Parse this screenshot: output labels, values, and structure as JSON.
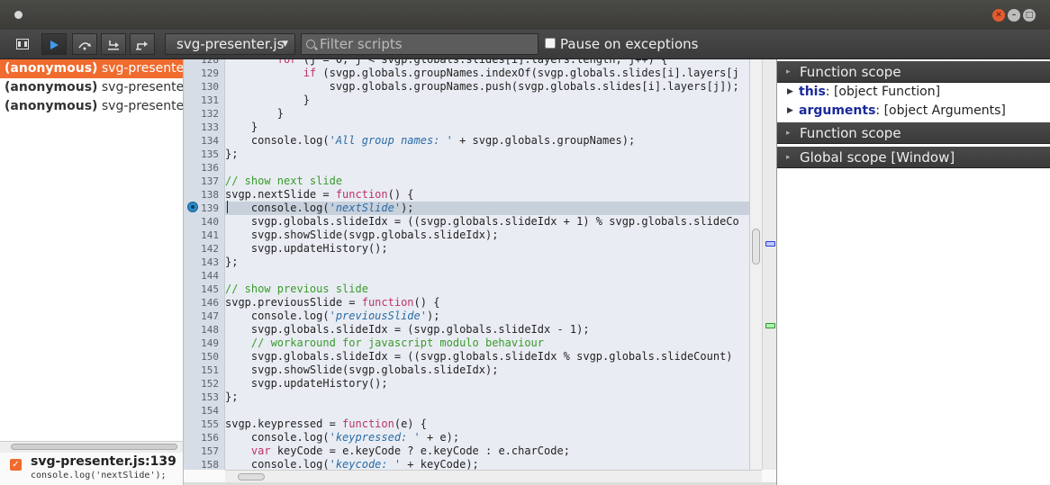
{
  "window": {
    "close": "✕",
    "minimize": "–",
    "maximize": "□"
  },
  "toolbar": {
    "script_name": "svg-presenter.js",
    "filter_placeholder": "Filter scripts",
    "pause_label": "Pause on exceptions"
  },
  "callstack": [
    {
      "fn": "(anonymous)",
      "file": "svg-presenter.js",
      "selected": true
    },
    {
      "fn": "(anonymous)",
      "file": "svg-presenter.js",
      "selected": false
    },
    {
      "fn": "(anonymous)",
      "file": "svg-presenter.js",
      "selected": false
    }
  ],
  "breakpoint": {
    "location": "svg-presenter.js:139",
    "source": "console.log('nextSlide');"
  },
  "editor": {
    "current_line": 139,
    "lines": [
      {
        "n": "128",
        "code": "        for (j = 0; j < svgp.globals.slides[i].layers.length; j++) {"
      },
      {
        "n": "129",
        "code": "            if (svgp.globals.groupNames.indexOf(svgp.globals.slides[i].layers[j"
      },
      {
        "n": "130",
        "code": "                svgp.globals.groupNames.push(svgp.globals.slides[i].layers[j]);"
      },
      {
        "n": "131",
        "code": "            }"
      },
      {
        "n": "132",
        "code": "        }"
      },
      {
        "n": "133",
        "code": "    }"
      },
      {
        "n": "134",
        "code": "    console.log('All group names: ' + svgp.globals.groupNames);"
      },
      {
        "n": "135",
        "code": "};"
      },
      {
        "n": "136",
        "code": ""
      },
      {
        "n": "137",
        "code": "// show next slide"
      },
      {
        "n": "138",
        "code": "svgp.nextSlide = function() {"
      },
      {
        "n": "139",
        "code": "    console.log('nextSlide');"
      },
      {
        "n": "140",
        "code": "    svgp.globals.slideIdx = ((svgp.globals.slideIdx + 1) % svgp.globals.slideCo"
      },
      {
        "n": "141",
        "code": "    svgp.showSlide(svgp.globals.slideIdx);"
      },
      {
        "n": "142",
        "code": "    svgp.updateHistory();"
      },
      {
        "n": "143",
        "code": "};"
      },
      {
        "n": "144",
        "code": ""
      },
      {
        "n": "145",
        "code": "// show previous slide"
      },
      {
        "n": "146",
        "code": "svgp.previousSlide = function() {"
      },
      {
        "n": "147",
        "code": "    console.log('previousSlide');"
      },
      {
        "n": "148",
        "code": "    svgp.globals.slideIdx = (svgp.globals.slideIdx - 1);"
      },
      {
        "n": "149",
        "code": "    // workaround for javascript modulo behaviour"
      },
      {
        "n": "150",
        "code": "    svgp.globals.slideIdx = ((svgp.globals.slideIdx % svgp.globals.slideCount)"
      },
      {
        "n": "151",
        "code": "    svgp.showSlide(svgp.globals.slideIdx);"
      },
      {
        "n": "152",
        "code": "    svgp.updateHistory();"
      },
      {
        "n": "153",
        "code": "};"
      },
      {
        "n": "154",
        "code": ""
      },
      {
        "n": "155",
        "code": "svgp.keypressed = function(e) {"
      },
      {
        "n": "156",
        "code": "    console.log('keypressed: ' + e);"
      },
      {
        "n": "157",
        "code": "    var keyCode = e.keyCode ? e.keyCode : e.charCode;"
      },
      {
        "n": "158",
        "code": "    console.log('keycode: ' + keyCode);"
      }
    ]
  },
  "scope": {
    "sections": [
      {
        "title": "Function scope",
        "items": [
          {
            "name": "this",
            "value": "[object Function]"
          },
          {
            "name": "arguments",
            "value": "[object Arguments]"
          }
        ]
      },
      {
        "title": "Function scope",
        "items": []
      },
      {
        "title": "Global scope [Window]",
        "items": []
      }
    ]
  }
}
